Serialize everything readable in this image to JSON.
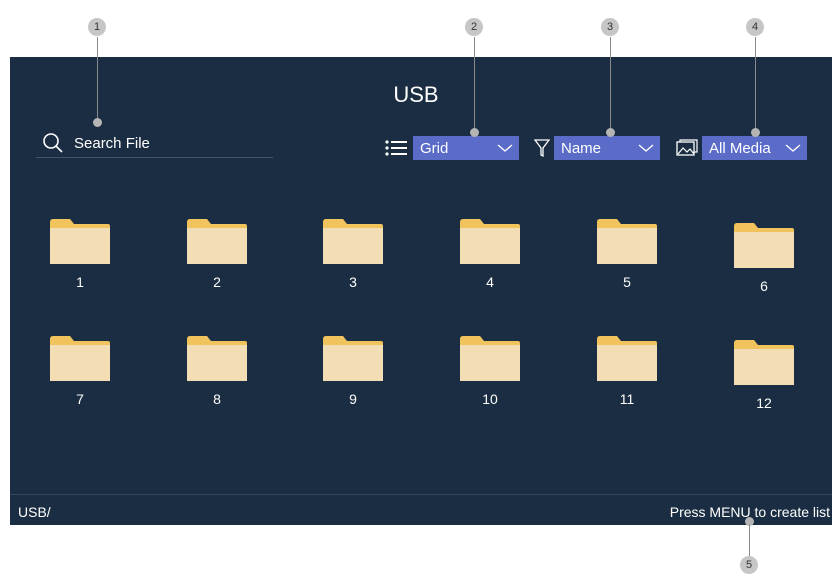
{
  "header": {
    "title": "USB"
  },
  "search": {
    "label": "Search File"
  },
  "toolbar": {
    "view": {
      "value": "Grid",
      "icon": "list-icon"
    },
    "sort": {
      "value": "Name",
      "icon": "filter-icon"
    },
    "media": {
      "value": "All Media",
      "icon": "image-icon"
    }
  },
  "folders": [
    "1",
    "2",
    "3",
    "4",
    "5",
    "6",
    "7",
    "8",
    "9",
    "10",
    "11",
    "12"
  ],
  "status": {
    "path": "USB/",
    "hint": "Press MENU to create list"
  },
  "callouts": [
    "1",
    "2",
    "3",
    "4",
    "5"
  ],
  "colors": {
    "background": "#1b2d42",
    "dropdown": "#5a6bc8",
    "folder": "#f2ddb5",
    "folder_tab": "#f0c35c"
  }
}
